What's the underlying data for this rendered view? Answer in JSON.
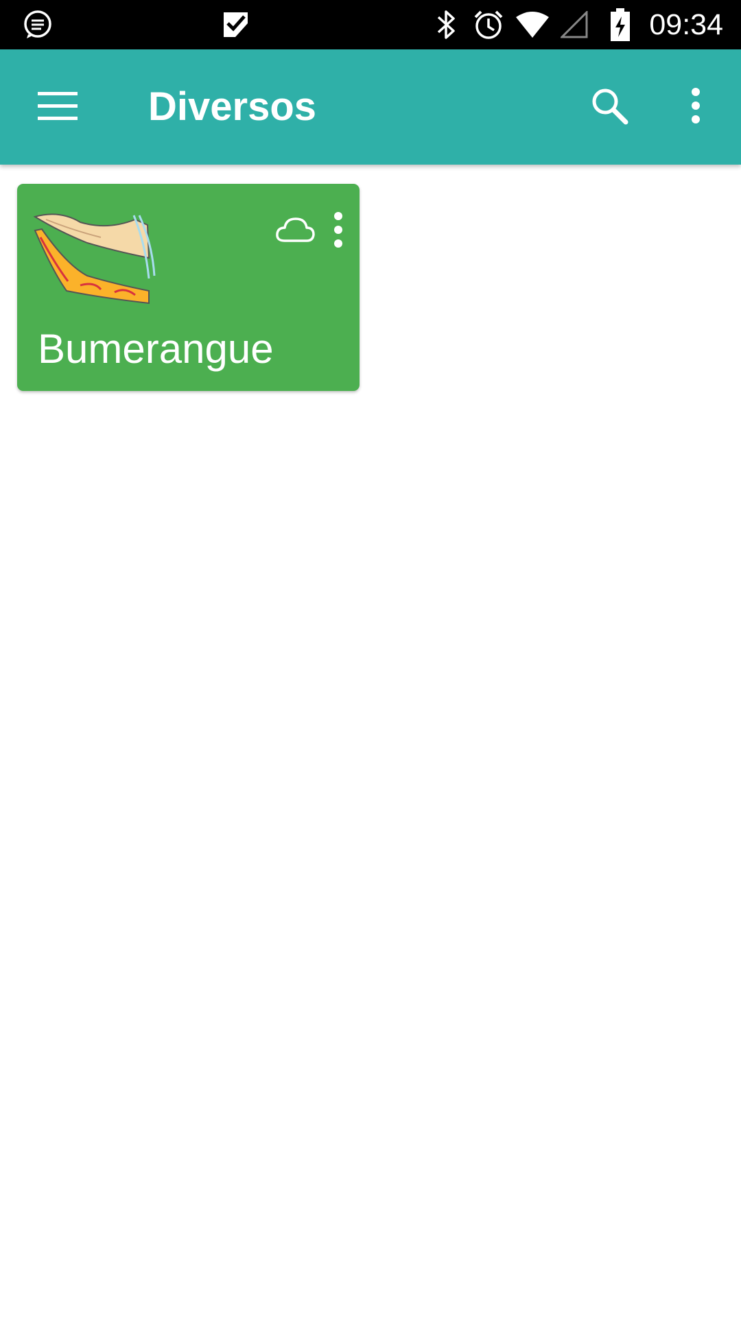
{
  "status_bar": {
    "time": "09:34",
    "icons": [
      "message-icon",
      "task-check-icon",
      "bluetooth-icon",
      "alarm-icon",
      "wifi-icon",
      "signal-icon",
      "battery-charging-icon"
    ]
  },
  "app_bar": {
    "title": "Diversos",
    "icons": [
      "menu-icon",
      "search-icon",
      "more-vert-icon"
    ],
    "color": "#2fb0a8"
  },
  "cards": [
    {
      "title": "Bumerangue",
      "color": "#4caf50",
      "icons": [
        "boomerang-image",
        "cloud-icon",
        "more-vert-icon"
      ]
    }
  ]
}
